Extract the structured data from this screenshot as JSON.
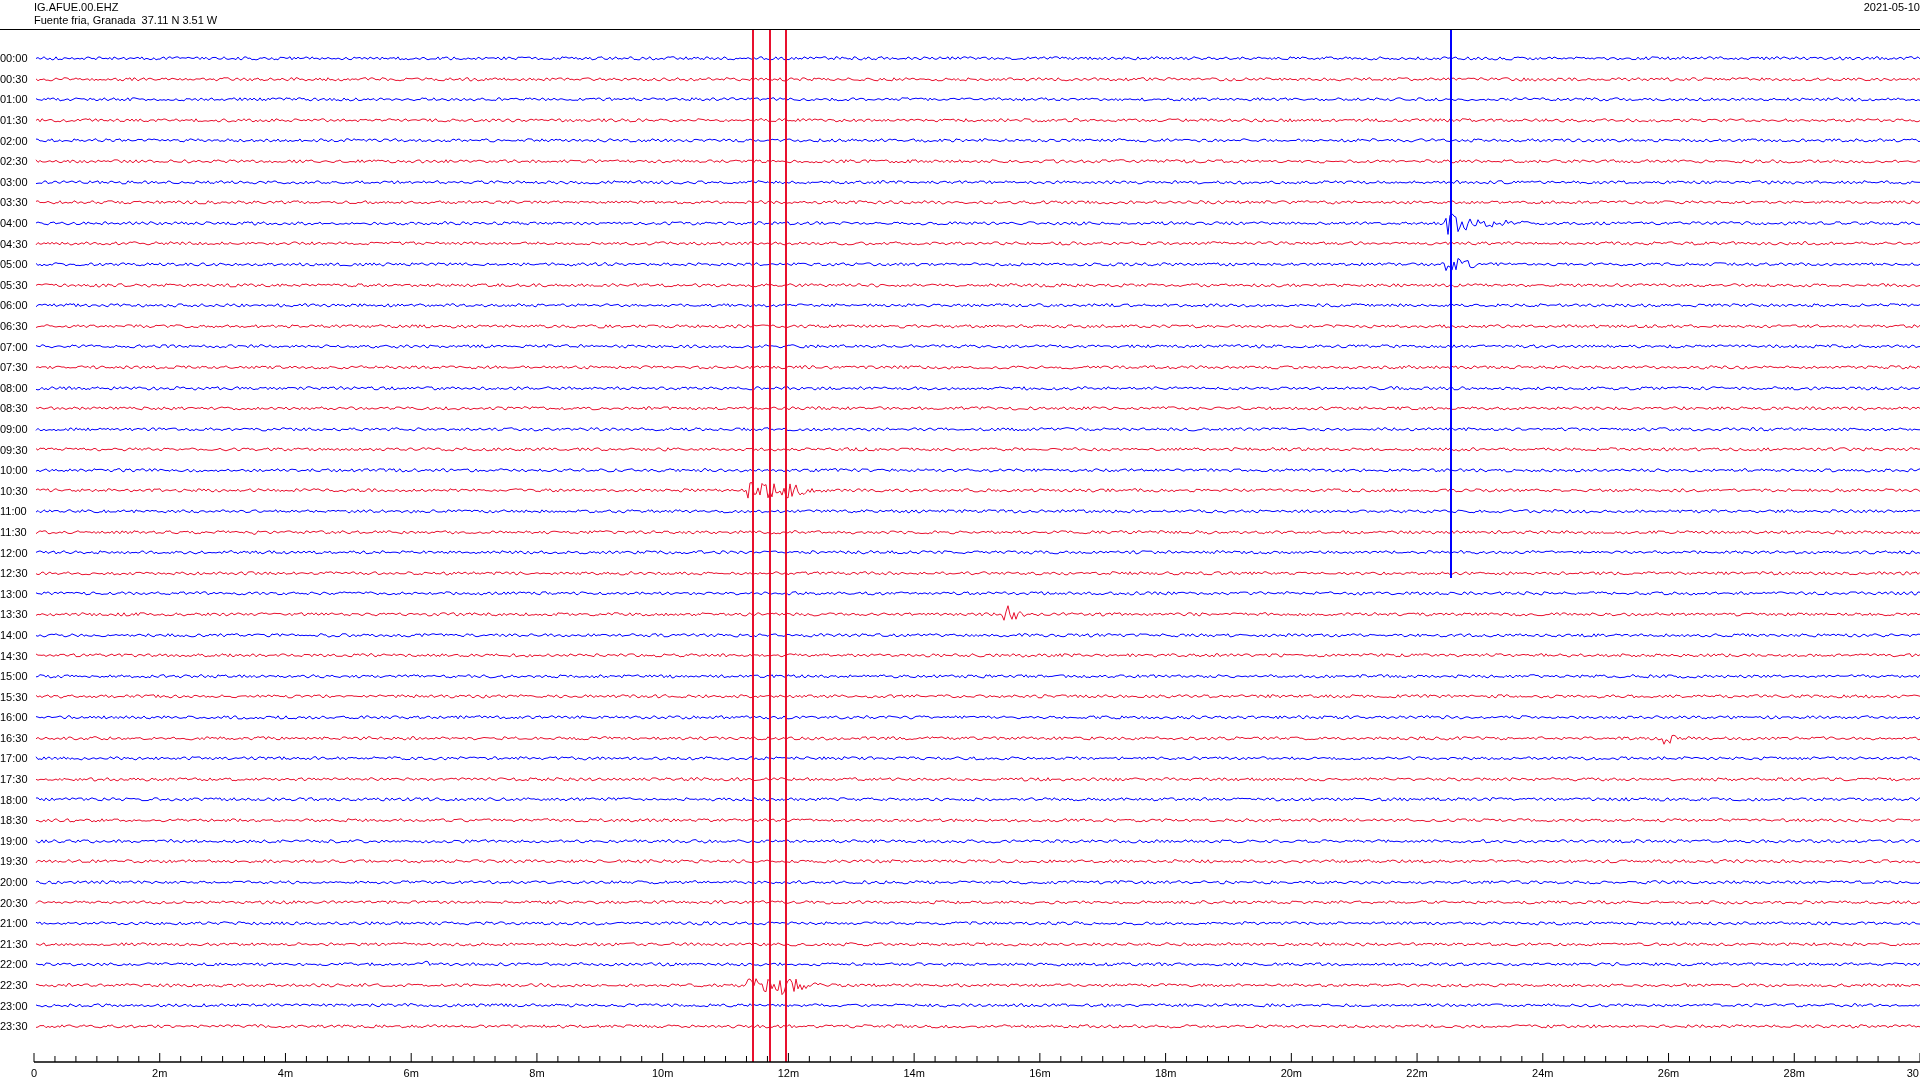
{
  "header": {
    "station": "IG.AFUE.00.EHZ",
    "location": "Fuente fria, Granada  37.11 N 3.51 W",
    "date": "2021-05-10"
  },
  "rows": [
    {
      "time": "00:00",
      "color": "#0000ff"
    },
    {
      "time": "00:30",
      "color": "#e8102e"
    },
    {
      "time": "01:00",
      "color": "#0000ff"
    },
    {
      "time": "01:30",
      "color": "#e8102e"
    },
    {
      "time": "02:00",
      "color": "#0000ff"
    },
    {
      "time": "02:30",
      "color": "#e8102e"
    },
    {
      "time": "03:00",
      "color": "#0000ff"
    },
    {
      "time": "03:30",
      "color": "#e8102e"
    },
    {
      "time": "04:00",
      "color": "#0000ff"
    },
    {
      "time": "04:30",
      "color": "#e8102e"
    },
    {
      "time": "05:00",
      "color": "#0000ff"
    },
    {
      "time": "05:30",
      "color": "#e8102e"
    },
    {
      "time": "06:00",
      "color": "#0000ff"
    },
    {
      "time": "06:30",
      "color": "#e8102e"
    },
    {
      "time": "07:00",
      "color": "#0000ff"
    },
    {
      "time": "07:30",
      "color": "#e8102e"
    },
    {
      "time": "08:00",
      "color": "#0000ff"
    },
    {
      "time": "08:30",
      "color": "#e8102e"
    },
    {
      "time": "09:00",
      "color": "#0000ff"
    },
    {
      "time": "09:30",
      "color": "#e8102e"
    },
    {
      "time": "10:00",
      "color": "#0000ff"
    },
    {
      "time": "10:30",
      "color": "#e8102e"
    },
    {
      "time": "11:00",
      "color": "#0000ff"
    },
    {
      "time": "11:30",
      "color": "#e8102e"
    },
    {
      "time": "12:00",
      "color": "#0000ff"
    },
    {
      "time": "12:30",
      "color": "#e8102e"
    },
    {
      "time": "13:00",
      "color": "#0000ff"
    },
    {
      "time": "13:30",
      "color": "#e8102e"
    },
    {
      "time": "14:00",
      "color": "#0000ff"
    },
    {
      "time": "14:30",
      "color": "#e8102e"
    },
    {
      "time": "15:00",
      "color": "#0000ff"
    },
    {
      "time": "15:30",
      "color": "#e8102e"
    },
    {
      "time": "16:00",
      "color": "#0000ff"
    },
    {
      "time": "16:30",
      "color": "#e8102e"
    },
    {
      "time": "17:00",
      "color": "#0000ff"
    },
    {
      "time": "17:30",
      "color": "#e8102e"
    },
    {
      "time": "18:00",
      "color": "#0000ff"
    },
    {
      "time": "18:30",
      "color": "#e8102e"
    },
    {
      "time": "19:00",
      "color": "#0000ff"
    },
    {
      "time": "19:30",
      "color": "#e8102e"
    },
    {
      "time": "20:00",
      "color": "#0000ff"
    },
    {
      "time": "20:30",
      "color": "#e8102e"
    },
    {
      "time": "21:00",
      "color": "#0000ff"
    },
    {
      "time": "21:30",
      "color": "#e8102e"
    },
    {
      "time": "22:00",
      "color": "#0000ff"
    },
    {
      "time": "22:30",
      "color": "#e8102e"
    },
    {
      "time": "23:00",
      "color": "#0000ff"
    },
    {
      "time": "23:30",
      "color": "#e8102e"
    }
  ],
  "axis": {
    "ticks": [
      "0",
      "2m",
      "4m",
      "6m",
      "8m",
      "10m",
      "12m",
      "14m",
      "16m",
      "18m",
      "20m",
      "22m",
      "24m",
      "26m",
      "28m",
      "30"
    ]
  }
}
